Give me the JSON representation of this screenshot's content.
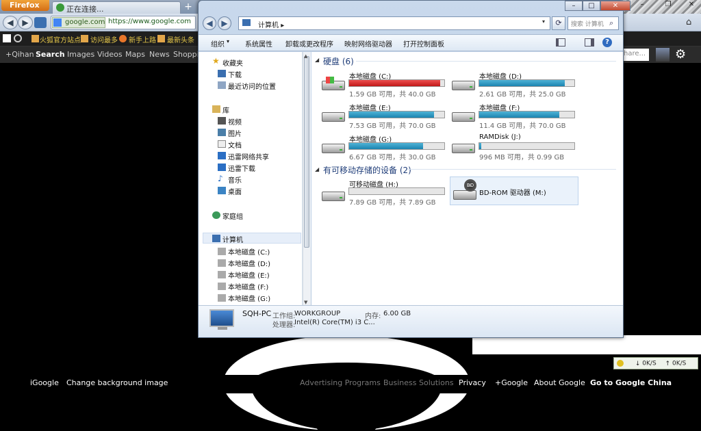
{
  "firefox": {
    "menu_button": "Firefox",
    "tab_title": "正在连接...",
    "new_tab": "+",
    "site_identity": "google.com",
    "url": "https://www.google.com",
    "bookmarks": [
      "火狐官方站点",
      "访问最多",
      "新手上路",
      "最新头条"
    ]
  },
  "google_bar": {
    "items": [
      "+Qihan",
      "Search",
      "Images",
      "Videos",
      "Maps",
      "News",
      "Shoppin"
    ],
    "active": "Search",
    "share_placeholder": "hare..."
  },
  "explorer": {
    "address": [
      "计算机"
    ],
    "search_placeholder": "搜索 计算机",
    "toolbar": [
      "组织",
      "系统属性",
      "卸载或更改程序",
      "映射网络驱动器",
      "打开控制面板"
    ],
    "nav": {
      "favorites": "收藏夹",
      "favorites_items": [
        "下载",
        "最近访问的位置"
      ],
      "libraries": "库",
      "library_items": [
        "视频",
        "图片",
        "文档",
        "迅雷网络共享",
        "迅雷下载",
        "音乐",
        "桌面"
      ],
      "homegroup": "家庭组",
      "computer": "计算机",
      "computer_items": [
        "本地磁盘 (C:)",
        "本地磁盘 (D:)",
        "本地磁盘 (E:)",
        "本地磁盘 (F:)",
        "本地磁盘 (G:)"
      ]
    },
    "hard_disks_header": "硬盘 (6)",
    "drives": [
      {
        "name": "本地磁盘 (C:)",
        "info": "1.59 GB 可用，共 40.0 GB",
        "used_fraction": 0.96,
        "critical": true
      },
      {
        "name": "本地磁盘 (D:)",
        "info": "2.61 GB 可用，共 25.0 GB",
        "used_fraction": 0.9,
        "critical": false
      },
      {
        "name": "本地磁盘 (E:)",
        "info": "7.53 GB 可用，共 70.0 GB",
        "used_fraction": 0.89,
        "critical": false
      },
      {
        "name": "本地磁盘 (F:)",
        "info": "11.4 GB 可用，共 70.0 GB",
        "used_fraction": 0.84,
        "critical": false
      },
      {
        "name": "本地磁盘 (G:)",
        "info": "6.67 GB 可用，共 30.0 GB",
        "used_fraction": 0.78,
        "critical": false
      },
      {
        "name": "RAMDisk (J:)",
        "info": "996 MB 可用，共 0.99 GB",
        "used_fraction": 0.02,
        "critical": false
      }
    ],
    "removable_header": "有可移动存储的设备 (2)",
    "removable": [
      {
        "name": "可移动磁盘 (H:)",
        "info": "7.89 GB 可用，共 7.89 GB",
        "used_fraction": 0.0
      },
      {
        "name": "BD-ROM 驱动器 (M:)",
        "disc_label": "BD"
      }
    ],
    "details": {
      "pc_name": "SQH-PC",
      "workgroup_label": "工作组:",
      "workgroup": "WORKGROUP",
      "memory_label": "内存:",
      "memory": "6.00 GB",
      "cpu_label": "处理器:",
      "cpu": "Intel(R) Core(TM) i3 C..."
    }
  },
  "network_widget": {
    "down": "0K/S",
    "up": "0K/S"
  },
  "footer": {
    "left": [
      "iGoogle",
      "Change background image"
    ],
    "right": [
      "Advertising Programs",
      "Business Solutions",
      "Privacy",
      "+Google",
      "About Google",
      "Go to Google China"
    ]
  }
}
